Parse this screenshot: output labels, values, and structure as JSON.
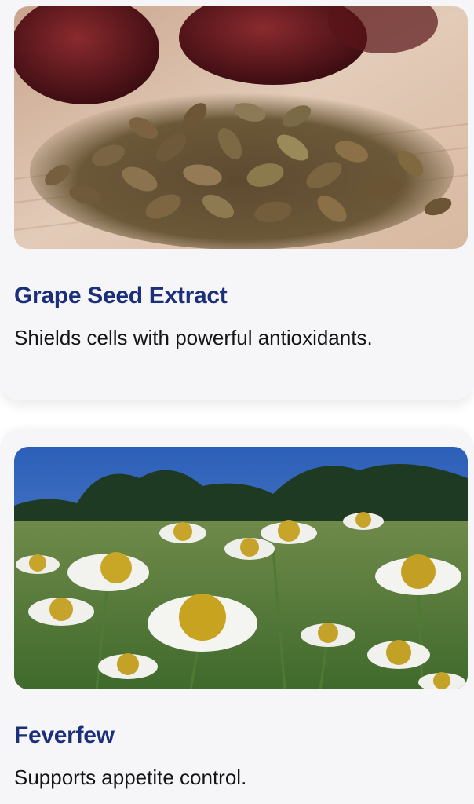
{
  "cards": [
    {
      "title": "Grape Seed Extract",
      "description": "Shields cells with powerful antioxidants.",
      "image": "grape-seeds-photo"
    },
    {
      "title": "Feverfew",
      "description": "Supports appetite control.",
      "image": "feverfew-flowers-photo"
    }
  ],
  "colors": {
    "title": "#1b2f7a",
    "text": "#151515",
    "card_background": "#f6f6f9"
  }
}
